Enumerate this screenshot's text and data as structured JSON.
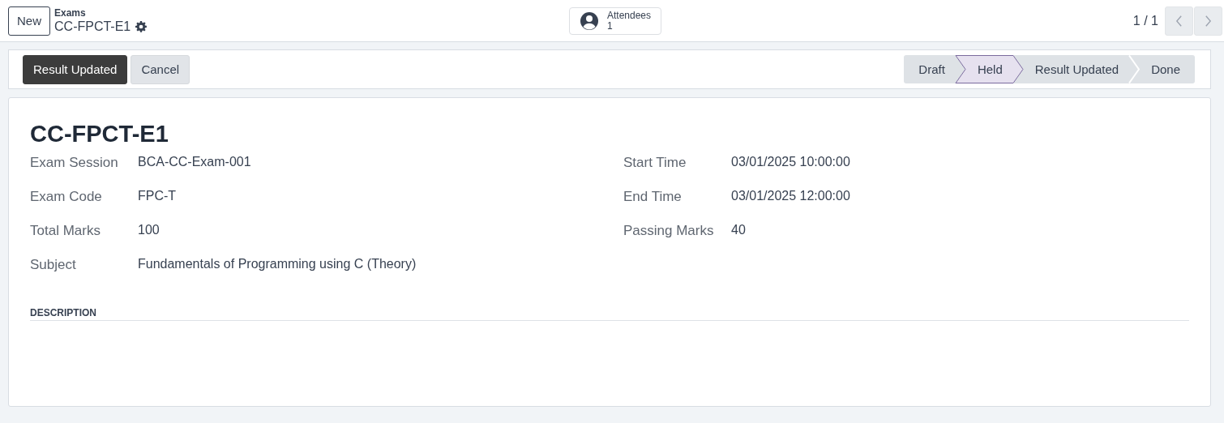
{
  "topbar": {
    "new_button": "New",
    "breadcrumb": "Exams",
    "record_name": "CC-FPCT-E1",
    "attendees": {
      "label": "Attendees",
      "count": "1"
    },
    "pager": "1 / 1"
  },
  "actions": [
    {
      "label": "Result Updated",
      "kind": "primary"
    },
    {
      "label": "Cancel",
      "kind": "secondary"
    }
  ],
  "stages": [
    {
      "label": "Draft",
      "selected": false
    },
    {
      "label": "Held",
      "selected": true
    },
    {
      "label": "Result Updated",
      "selected": false
    },
    {
      "label": "Done",
      "selected": false
    }
  ],
  "form": {
    "title": "CC-FPCT-E1",
    "left_fields": [
      {
        "label": "Exam Session",
        "value": "BCA-CC-Exam-001"
      },
      {
        "label": "Exam Code",
        "value": "FPC-T"
      },
      {
        "label": "Total Marks",
        "value": "100"
      },
      {
        "label": "Subject",
        "value": "Fundamentals of Programming using C (Theory)"
      }
    ],
    "right_fields": [
      {
        "label": "Start Time",
        "value": "03/01/2025 10:00:00"
      },
      {
        "label": "End Time",
        "value": "03/01/2025 12:00:00"
      },
      {
        "label": "Passing Marks",
        "value": "40"
      }
    ],
    "section": "DESCRIPTION"
  }
}
